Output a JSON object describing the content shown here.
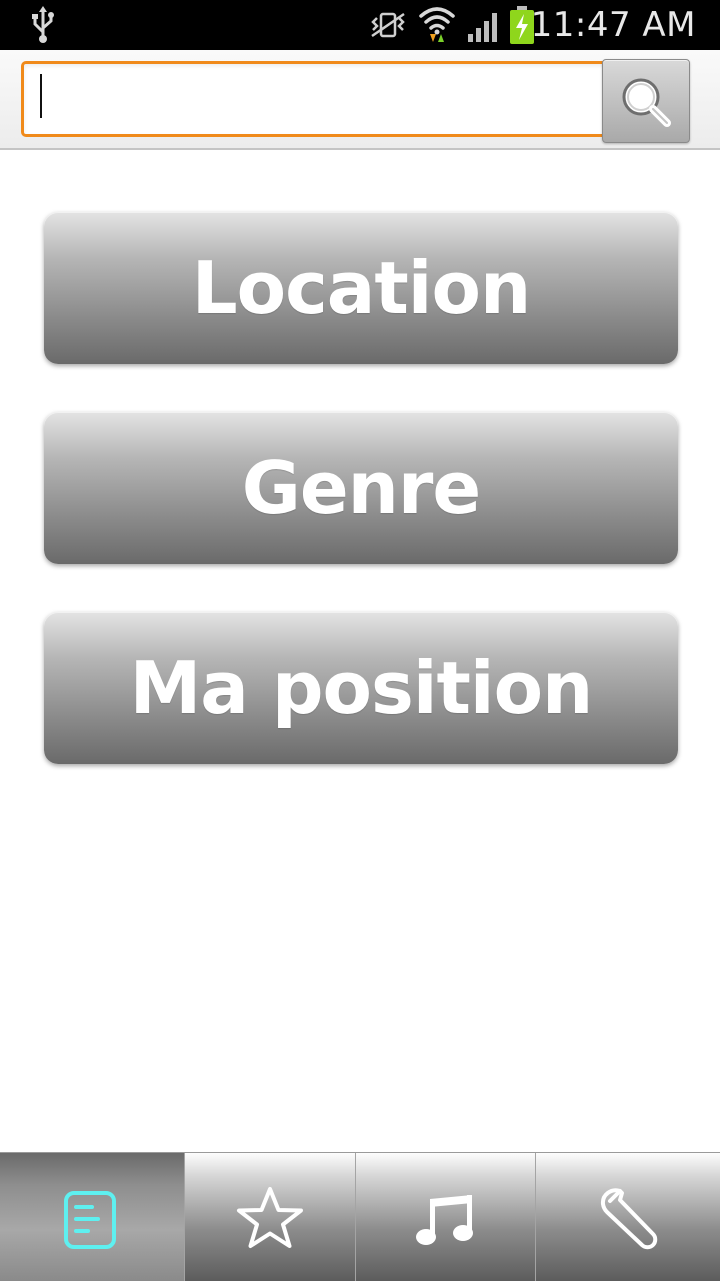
{
  "status_bar": {
    "time": "11:47 AM",
    "icons": [
      "usb-icon",
      "vibrate-icon",
      "wifi-icon",
      "signal-icon",
      "battery-charging-icon"
    ]
  },
  "search": {
    "value": "",
    "placeholder": "",
    "button_icon": "search-icon"
  },
  "menu": {
    "items": [
      {
        "label": "Location"
      },
      {
        "label": "Genre"
      },
      {
        "label": "Ma position"
      }
    ]
  },
  "tabs": [
    {
      "icon": "list-icon",
      "active": true
    },
    {
      "icon": "star-icon",
      "active": false
    },
    {
      "icon": "music-note-icon",
      "active": false
    },
    {
      "icon": "wrench-icon",
      "active": false
    }
  ],
  "colors": {
    "search_focus": "#f08a1a",
    "active_tab_icon": "#5ef0f0"
  }
}
